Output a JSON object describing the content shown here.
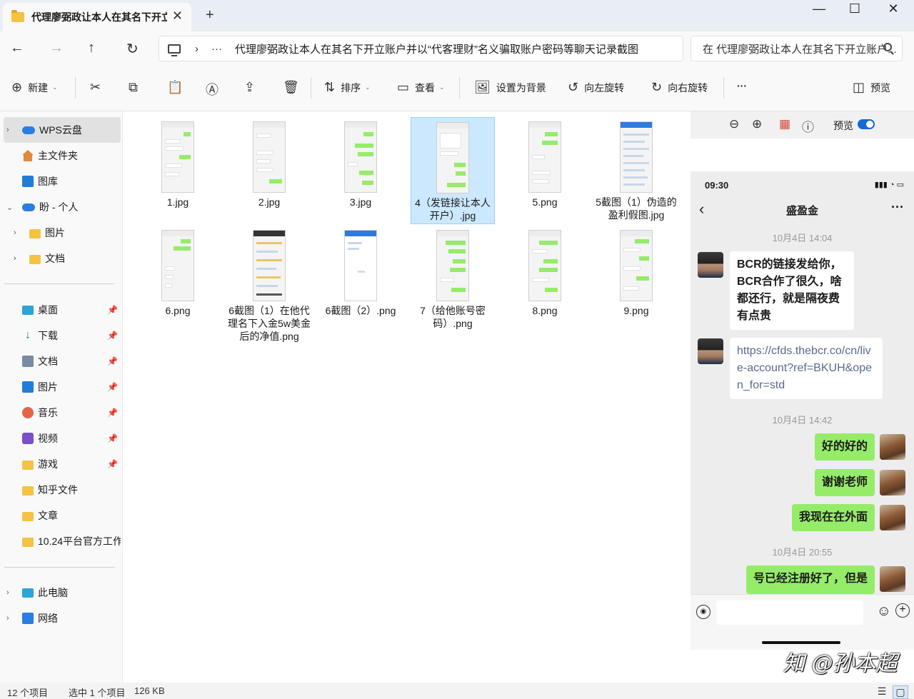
{
  "window": {
    "tab_title": "代理廖弼政让本人在其名下开立账户并以“代客理财”名义骗取账户密码等聊天记录截图",
    "tab_close": "✕",
    "new_tab": "+",
    "minimize": "—",
    "maximize": "☐",
    "close": "✕"
  },
  "address": {
    "back": "←",
    "forward": "→",
    "up": "↑",
    "refresh": "↻",
    "sep": "›",
    "ellipsis": "···",
    "path": "代理廖弼政让本人在其名下开立账户并以“代客理财”名义骗取账户密码等聊天记录截图",
    "search_placeholder": "在 代理廖弼政让本人在其名下开立账户..."
  },
  "toolbar": {
    "new_label": "新建",
    "sort_label": "排序",
    "view_label": "查看",
    "set_bg_label": "设置为背景",
    "rotate_left_label": "向左旋转",
    "rotate_right_label": "向右旋转",
    "more_label": "···",
    "preview_label": "预览"
  },
  "sidebar": {
    "items": [
      {
        "label": "WPS云盘"
      },
      {
        "label": "主文件夹"
      },
      {
        "label": "图库"
      },
      {
        "label": "盼 - 个人"
      },
      {
        "label": "图片"
      },
      {
        "label": "文档"
      },
      {
        "label": "桌面"
      },
      {
        "label": "下载"
      },
      {
        "label": "文档"
      },
      {
        "label": "图片"
      },
      {
        "label": "音乐"
      },
      {
        "label": "视频"
      },
      {
        "label": "游戏"
      },
      {
        "label": "知乎文件"
      },
      {
        "label": "文章"
      },
      {
        "label": "10.24平台官方工作"
      },
      {
        "label": "此电脑"
      },
      {
        "label": "网络"
      }
    ]
  },
  "files": [
    {
      "name": "1.jpg"
    },
    {
      "name": "2.jpg"
    },
    {
      "name": "3.jpg"
    },
    {
      "name": "4（发链接让本人开户）.jpg"
    },
    {
      "name": "5.png"
    },
    {
      "name": "5截图（1）伪造的盈利假图.jpg"
    },
    {
      "name": "6.png"
    },
    {
      "name": "6截图（1）在他代理名下入金5w美金后的净值.png"
    },
    {
      "name": "6截图（2）.png"
    },
    {
      "name": "7（给他账号密码）.png"
    },
    {
      "name": "8.png"
    },
    {
      "name": "9.png"
    }
  ],
  "preview": {
    "toggle_label": "预览",
    "phone": {
      "time": "09:30",
      "contact": "盛盈金",
      "messages": [
        {
          "time": "10月4日 14:04"
        },
        {
          "text": "BCR的链接发给你，BCR合作了很久，啥都还行，就是隔夜费有点贵"
        },
        {
          "text": "https://cfds.thebcr.co/cn/live-account?ref=BKUH&open_for=std"
        },
        {
          "time": "10月4日 14:42"
        },
        {
          "text": "好的好的"
        },
        {
          "text": "谢谢老师"
        },
        {
          "text": "我现在在外面"
        },
        {
          "time": "10月4日 20:55"
        },
        {
          "text": "号已经注册好了，但是"
        }
      ]
    },
    "watermark": "知 @孙本超"
  },
  "status": {
    "count": "12 个项目",
    "selected": "选中 1 个项目",
    "size": "126 KB"
  }
}
